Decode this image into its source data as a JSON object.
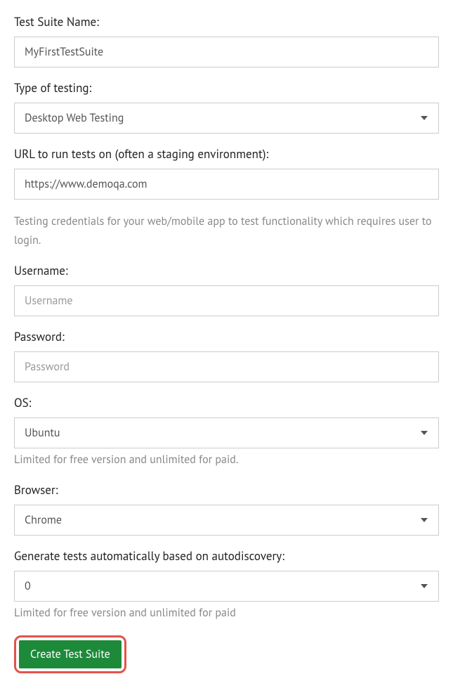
{
  "fields": {
    "testSuiteName": {
      "label": "Test Suite Name:",
      "value": "MyFirstTestSuite"
    },
    "typeOfTesting": {
      "label": "Type of testing:",
      "selected": "Desktop Web Testing"
    },
    "url": {
      "label": "URL to run tests on (often a staging environment):",
      "value": "https://www.demoqa.com"
    },
    "credentialsInfo": "Testing credentials for your web/mobile app to test functionality which requires user to login.",
    "username": {
      "label": "Username:",
      "placeholder": "Username",
      "value": ""
    },
    "password": {
      "label": "Password:",
      "placeholder": "Password",
      "value": ""
    },
    "os": {
      "label": "OS:",
      "selected": "Ubuntu",
      "help": "Limited for free version and unlimited for paid."
    },
    "browser": {
      "label": "Browser:",
      "selected": "Chrome"
    },
    "autodiscovery": {
      "label": "Generate tests automatically based on autodiscovery:",
      "selected": "0",
      "help": "Limited for free version and unlimited for paid"
    }
  },
  "submit": {
    "label": "Create Test Suite"
  }
}
